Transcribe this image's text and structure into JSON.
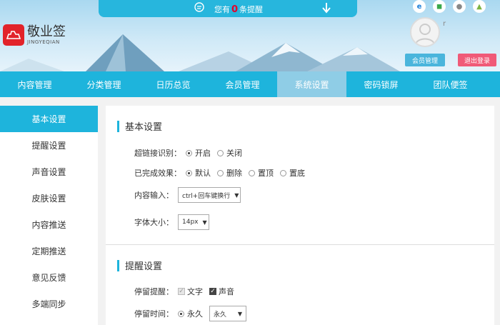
{
  "notice": {
    "prefix": "您有",
    "count": "0",
    "suffix": "条提醒"
  },
  "logo": {
    "cn": "敬业签",
    "en": "JINGYEQIAN"
  },
  "user": {
    "name": "r",
    "member_button": "会员管理",
    "logout_button": "退出登录"
  },
  "nav": [
    "内容管理",
    "分类管理",
    "日历总览",
    "会员管理",
    "系统设置",
    "密码锁屏",
    "团队便签"
  ],
  "sidebar": [
    "基本设置",
    "提醒设置",
    "声音设置",
    "皮肤设置",
    "内容推送",
    "定期推送",
    "意见反馈",
    "多端同步"
  ],
  "basic": {
    "title": "基本设置",
    "hyperlink_label": "超链接识别：",
    "hyperlink_on": "开启",
    "hyperlink_off": "关闭",
    "done_label": "已完成效果：",
    "done_default": "默认",
    "done_delete": "删除",
    "done_top": "置顶",
    "done_bottom": "置底",
    "input_label": "内容输入：",
    "input_value": "ctrl+回车键换行",
    "font_label": "字体大小：",
    "font_value": "14px"
  },
  "remind": {
    "title": "提醒设置",
    "stay_label": "停留提醒：",
    "stay_text": "文字",
    "stay_sound": "声音",
    "stay_time_label": "停留时间：",
    "stay_time_radio": "永久",
    "stay_time_value": "永久"
  },
  "colors": {
    "accent": "#1eb4dc",
    "logout": "#f05a78",
    "logo": "#e2232a"
  }
}
